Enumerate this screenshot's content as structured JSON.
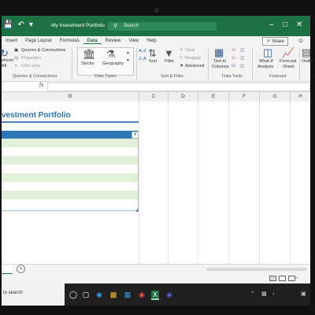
{
  "window": {
    "title": "My Investment Portfolio",
    "search_placeholder": "Search"
  },
  "menu": {
    "tabs": [
      "Insert",
      "Page Layout",
      "Formulas",
      "Data",
      "Review",
      "View",
      "Help"
    ],
    "active_tab": "Data",
    "share": "Share"
  },
  "ribbon": {
    "refresh_label_1": "efresh",
    "refresh_label_2": "All",
    "queries": "Queries & Connections",
    "properties": "Properties",
    "edit_links": "Edit Links",
    "group_queries": "Queries & Connections",
    "stocks": "Stocks",
    "geography": "Geography",
    "group_datatypes": "Data Types",
    "sort": "Sort",
    "filter": "Filter",
    "clear": "Clear",
    "reapply": "Reapply",
    "advanced": "Advanced",
    "group_sortfilter": "Sort & Filter",
    "text_to_columns_1": "Text to",
    "text_to_columns_2": "Columns",
    "group_datatools": "Data Tools",
    "whatif_1": "What-If",
    "whatif_2": "Analysis",
    "forecast_sheet_1": "Forecast",
    "forecast_sheet_2": "Sheet",
    "group_forecast": "Forecast",
    "outline": "Outlin"
  },
  "columns": [
    "B",
    "C",
    "D",
    "E",
    "F",
    "G",
    "H"
  ],
  "sheet": {
    "title": "vestment Portfolio"
  },
  "taskbar": {
    "search_text": "to search"
  },
  "colors": {
    "excel_green": "#1e7145",
    "table_header": "#2e75b6",
    "band": "#e2f0d9"
  }
}
